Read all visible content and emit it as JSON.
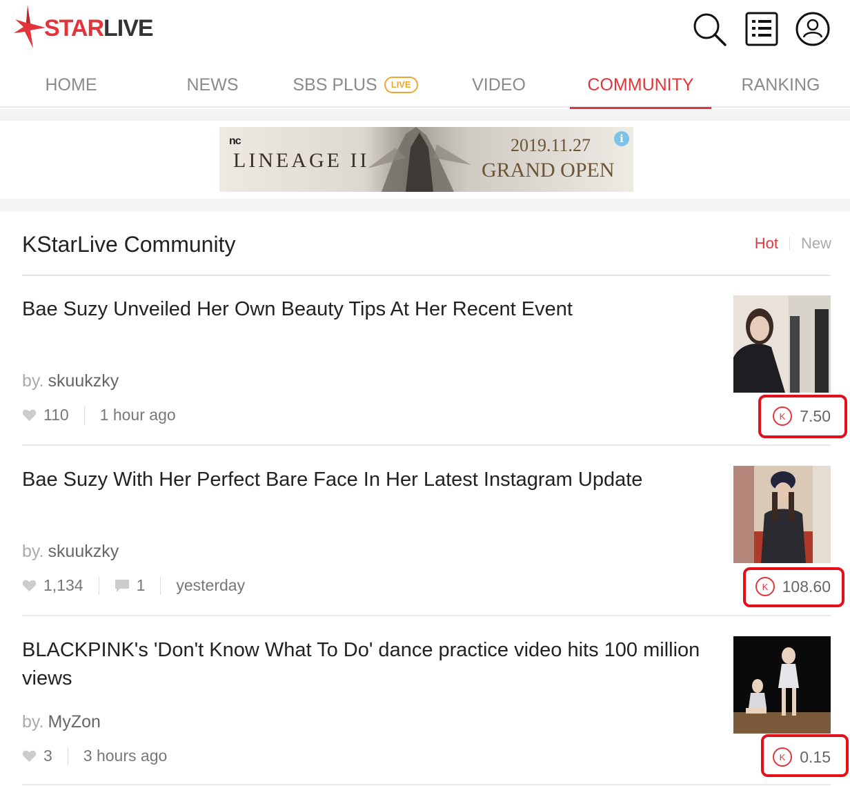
{
  "header": {
    "logo_part1": "STAR",
    "logo_part2": "LIVE",
    "icons": [
      "search-icon",
      "list-menu-icon",
      "user-icon"
    ]
  },
  "nav": {
    "items": [
      {
        "label": "HOME"
      },
      {
        "label": "NEWS"
      },
      {
        "label": "SBS PLUS",
        "badge": "LIVE"
      },
      {
        "label": "VIDEO"
      },
      {
        "label": "COMMUNITY",
        "active": true
      },
      {
        "label": "RANKING"
      }
    ]
  },
  "banner": {
    "brand": "nc",
    "title": "LINEAGE II",
    "date": "2019.11.27",
    "headline": "GRAND OPEN",
    "info": "i"
  },
  "community": {
    "title": "KStarLive Community",
    "sort_hot": "Hot",
    "sort_new": "New",
    "by_label": "by.",
    "posts": [
      {
        "title": "Bae Suzy Unveiled Her Own Beauty Tips At Her Recent Event",
        "author": "skuukzky",
        "likes": "110",
        "comments": "",
        "time": "1 hour ago",
        "reward": "7.50"
      },
      {
        "title": "Bae Suzy With Her Perfect Bare Face In Her Latest Instagram Update",
        "author": "skuukzky",
        "likes": "1,134",
        "comments": "1",
        "time": "yesterday",
        "reward": "108.60"
      },
      {
        "title": "BLACKPINK's 'Don't Know What To Do' dance practice video hits 100 million views",
        "author": "MyZon",
        "likes": "3",
        "comments": "",
        "time": "3 hours ago",
        "reward": "0.15"
      }
    ]
  },
  "colors": {
    "accent": "#e2353b",
    "live_badge": "#f2a52c",
    "highlight": "#e3101c"
  }
}
